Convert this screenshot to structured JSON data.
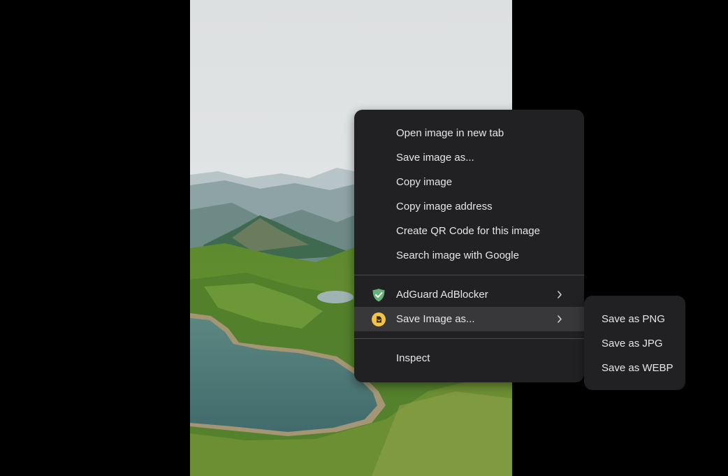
{
  "context_menu": {
    "items": [
      {
        "label": "Open image in new tab"
      },
      {
        "label": "Save image as..."
      },
      {
        "label": "Copy image"
      },
      {
        "label": "Copy image address"
      },
      {
        "label": "Create QR Code for this image"
      },
      {
        "label": "Search image with Google"
      }
    ],
    "extensions": [
      {
        "label": "AdGuard AdBlocker",
        "icon": "adguard-shield-icon",
        "has_submenu": true
      },
      {
        "label": "Save Image as...",
        "icon": "save-image-extension-icon",
        "has_submenu": true,
        "highlighted": true
      }
    ],
    "inspect_label": "Inspect"
  },
  "submenu": {
    "items": [
      {
        "label": "Save as PNG"
      },
      {
        "label": "Save as JPG"
      },
      {
        "label": "Save as WEBP"
      }
    ]
  },
  "colors": {
    "menu_bg": "#212124",
    "menu_highlight": "#38383b",
    "menu_text": "#e6e6e6",
    "adguard_green": "#67b279",
    "extension_yellow": "#f3c24b"
  }
}
